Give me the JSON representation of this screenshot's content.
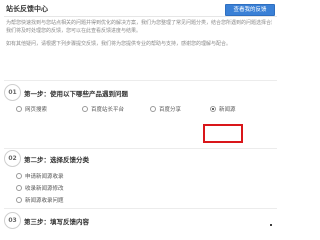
{
  "header": {
    "title": "站长反馈中心",
    "view_feedback_label": "查看我的反馈"
  },
  "intro": {
    "lines": [
      "为帮您快速找到与您站点相关的问题并得到优化的解决方案，我们为您整理了常见问题分类，结合您所遇到的问题选择合适的反馈方式，",
      "我们将及时处理您的反馈，您可以在此查看反馈进度与结果。",
      "如有其他疑问，请根据下列步骤提交反馈，我们将为您提供专业的帮助与支持，感谢您的理解与配合。"
    ]
  },
  "step1": {
    "num": "01",
    "title": "第一步：使用以下哪些产品遇到问题",
    "options": [
      {
        "label": "网页搜索",
        "checked": false
      },
      {
        "label": "百度站长平台",
        "checked": false
      },
      {
        "label": "百度分享",
        "checked": false
      },
      {
        "label": "新闻源",
        "checked": true
      }
    ]
  },
  "step2": {
    "num": "02",
    "title": "第二步：选择反馈分类",
    "options": [
      {
        "label": "申请新闻源收录",
        "checked": false
      },
      {
        "label": "收录新闻源修改",
        "checked": false
      },
      {
        "label": "新闻源收录问题",
        "checked": false
      }
    ]
  },
  "step3": {
    "num": "03",
    "title": "第三步：填写反馈内容"
  }
}
